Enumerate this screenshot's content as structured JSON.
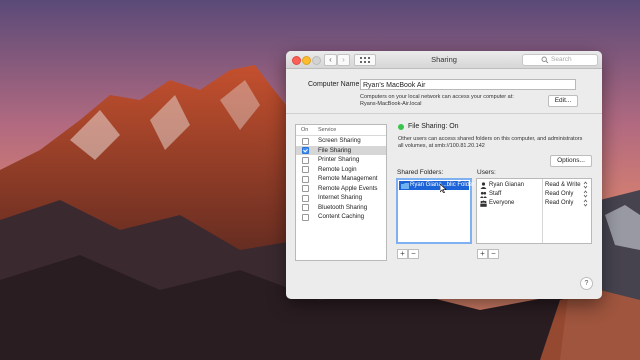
{
  "window": {
    "title": "Sharing",
    "search_placeholder": "Search"
  },
  "computer_name": {
    "label": "Computer Name:",
    "value": "Ryan's MacBook Air",
    "info_line1": "Computers on your local network can access your computer at:",
    "info_line2": "Ryans-MacBook-Air.local",
    "edit_button": "Edit..."
  },
  "services": {
    "header_on": "On",
    "header_service": "Service",
    "items": [
      {
        "label": "Screen Sharing",
        "on": false,
        "selected": false
      },
      {
        "label": "File Sharing",
        "on": true,
        "selected": true
      },
      {
        "label": "Printer Sharing",
        "on": false,
        "selected": false
      },
      {
        "label": "Remote Login",
        "on": false,
        "selected": false
      },
      {
        "label": "Remote Management",
        "on": false,
        "selected": false
      },
      {
        "label": "Remote Apple Events",
        "on": false,
        "selected": false
      },
      {
        "label": "Internet Sharing",
        "on": false,
        "selected": false
      },
      {
        "label": "Bluetooth Sharing",
        "on": false,
        "selected": false
      },
      {
        "label": "Content Caching",
        "on": false,
        "selected": false
      }
    ]
  },
  "status": {
    "text": "File Sharing: On",
    "color": "#3bc44b",
    "description_line1": "Other users can access shared folders on this computer, and administrators",
    "description_line2": "all volumes, at smb://100.81.20.142",
    "options_button": "Options..."
  },
  "shared_folders": {
    "label": "Shared Folders:",
    "items": [
      {
        "name": "Ryan Giana...blic Folder",
        "icon": "folder-icon"
      }
    ]
  },
  "users": {
    "label": "Users:",
    "items": [
      {
        "name": "Ryan Gianan",
        "permission": "Read & Write",
        "icon": "person-icon"
      },
      {
        "name": "Staff",
        "permission": "Read Only",
        "icon": "group-icon"
      },
      {
        "name": "Everyone",
        "permission": "Read Only",
        "icon": "everyone-icon"
      }
    ]
  },
  "controls": {
    "add": "+",
    "remove": "−",
    "help": "?"
  },
  "colors": {
    "selection": "#1d63d8",
    "checkbox_on": "#3d8ef5"
  }
}
